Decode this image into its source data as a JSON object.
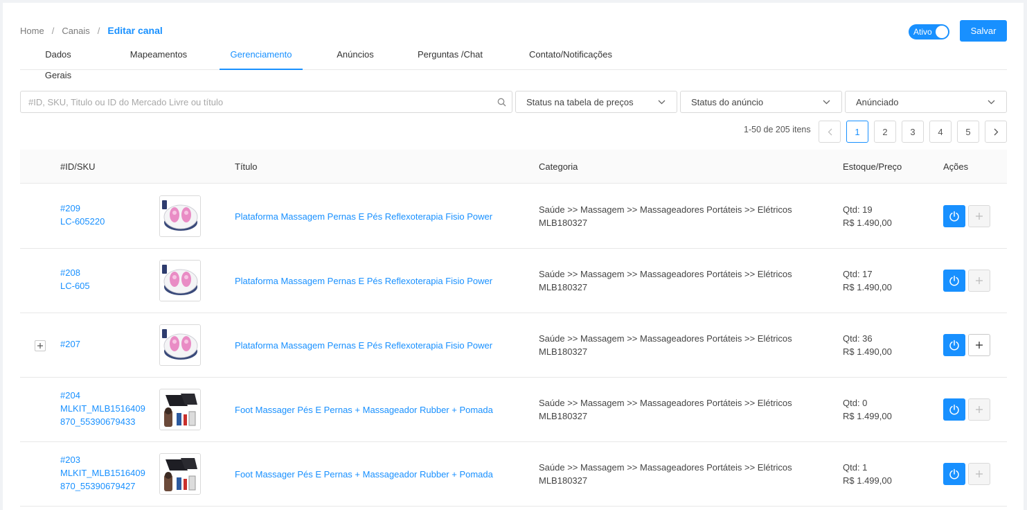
{
  "breadcrumb": {
    "home": "Home",
    "sep1": "/",
    "channels": "Canais",
    "sep2": "/",
    "current": "Editar canal"
  },
  "status_toggle": {
    "label": "Ativo",
    "on": true
  },
  "save_button": "Salvar",
  "tabs": [
    {
      "label": "Dados Gerais"
    },
    {
      "label": "Mapeamentos"
    },
    {
      "label": "Gerenciamento",
      "active": true
    },
    {
      "label": "Anúncios"
    },
    {
      "label": "Perguntas /Chat"
    },
    {
      "label": "Contato/Notificações"
    }
  ],
  "search": {
    "placeholder": "#ID, SKU, Titulo ou ID do Mercado Livre ou título",
    "value": ""
  },
  "filters": {
    "price_status": "Status na tabela de preços",
    "ad_status": "Status do anúncio",
    "advertised": "Anúnciado"
  },
  "pagination": {
    "info": "1-50 de 205 itens",
    "pages": [
      "1",
      "2",
      "3",
      "4",
      "5"
    ],
    "current": "1"
  },
  "table": {
    "headers": {
      "id_sku": "#ID/SKU",
      "title": "Título",
      "category": "Categoria",
      "stock_price": "Estoque/Preço",
      "actions": "Ações"
    },
    "rows": [
      {
        "id": "#209",
        "sku": "LC-605220",
        "sku2": "",
        "title": "Plataforma Massagem Pernas E Pés Reflexoterapia Fisio Power",
        "category": "Saúde >> Massagem >> Massageadores Portáteis >> Elétricos",
        "category_id": "MLB180327",
        "qty": "Qtd: 19",
        "price": "R$ 1.490,00",
        "expandable": false,
        "image": "foot-spa"
      },
      {
        "id": "#208",
        "sku": "LC-605",
        "sku2": "",
        "title": "Plataforma Massagem Pernas E Pés Reflexoterapia Fisio Power",
        "category": "Saúde >> Massagem >> Massageadores Portáteis >> Elétricos",
        "category_id": "MLB180327",
        "qty": "Qtd: 17",
        "price": "R$ 1.490,00",
        "expandable": false,
        "image": "foot-spa"
      },
      {
        "id": "#207",
        "sku": "",
        "sku2": "",
        "title": "Plataforma Massagem Pernas E Pés Reflexoterapia Fisio Power",
        "category": "Saúde >> Massagem >> Massageadores Portáteis >> Elétricos",
        "category_id": "MLB180327",
        "qty": "Qtd: 36",
        "price": "R$ 1.490,00",
        "expandable": true,
        "image": "foot-spa"
      },
      {
        "id": "#204",
        "sku": "MLKIT_MLB1516409",
        "sku2": "870_55390679433",
        "title": "Foot Massager Pés E Pernas + Massageador Rubber + Pomada",
        "category": "Saúde >> Massagem >> Massageadores Portáteis >> Elétricos",
        "category_id": "MLB180327",
        "qty": "Qtd: 0",
        "price": "R$ 1.499,00",
        "expandable": false,
        "image": "foot-massager-kit"
      },
      {
        "id": "#203",
        "sku": "MLKIT_MLB1516409",
        "sku2": "870_55390679427",
        "title": "Foot Massager Pés E Pernas + Massageador Rubber + Pomada",
        "category": "Saúde >> Massagem >> Massageadores Portáteis >> Elétricos",
        "category_id": "MLB180327",
        "qty": "Qtd: 1",
        "price": "R$ 1.499,00",
        "expandable": false,
        "image": "foot-massager-kit"
      }
    ]
  },
  "colors": {
    "primary": "#1890ff",
    "border": "#d9d9d9",
    "header_bg": "#fafafa"
  }
}
